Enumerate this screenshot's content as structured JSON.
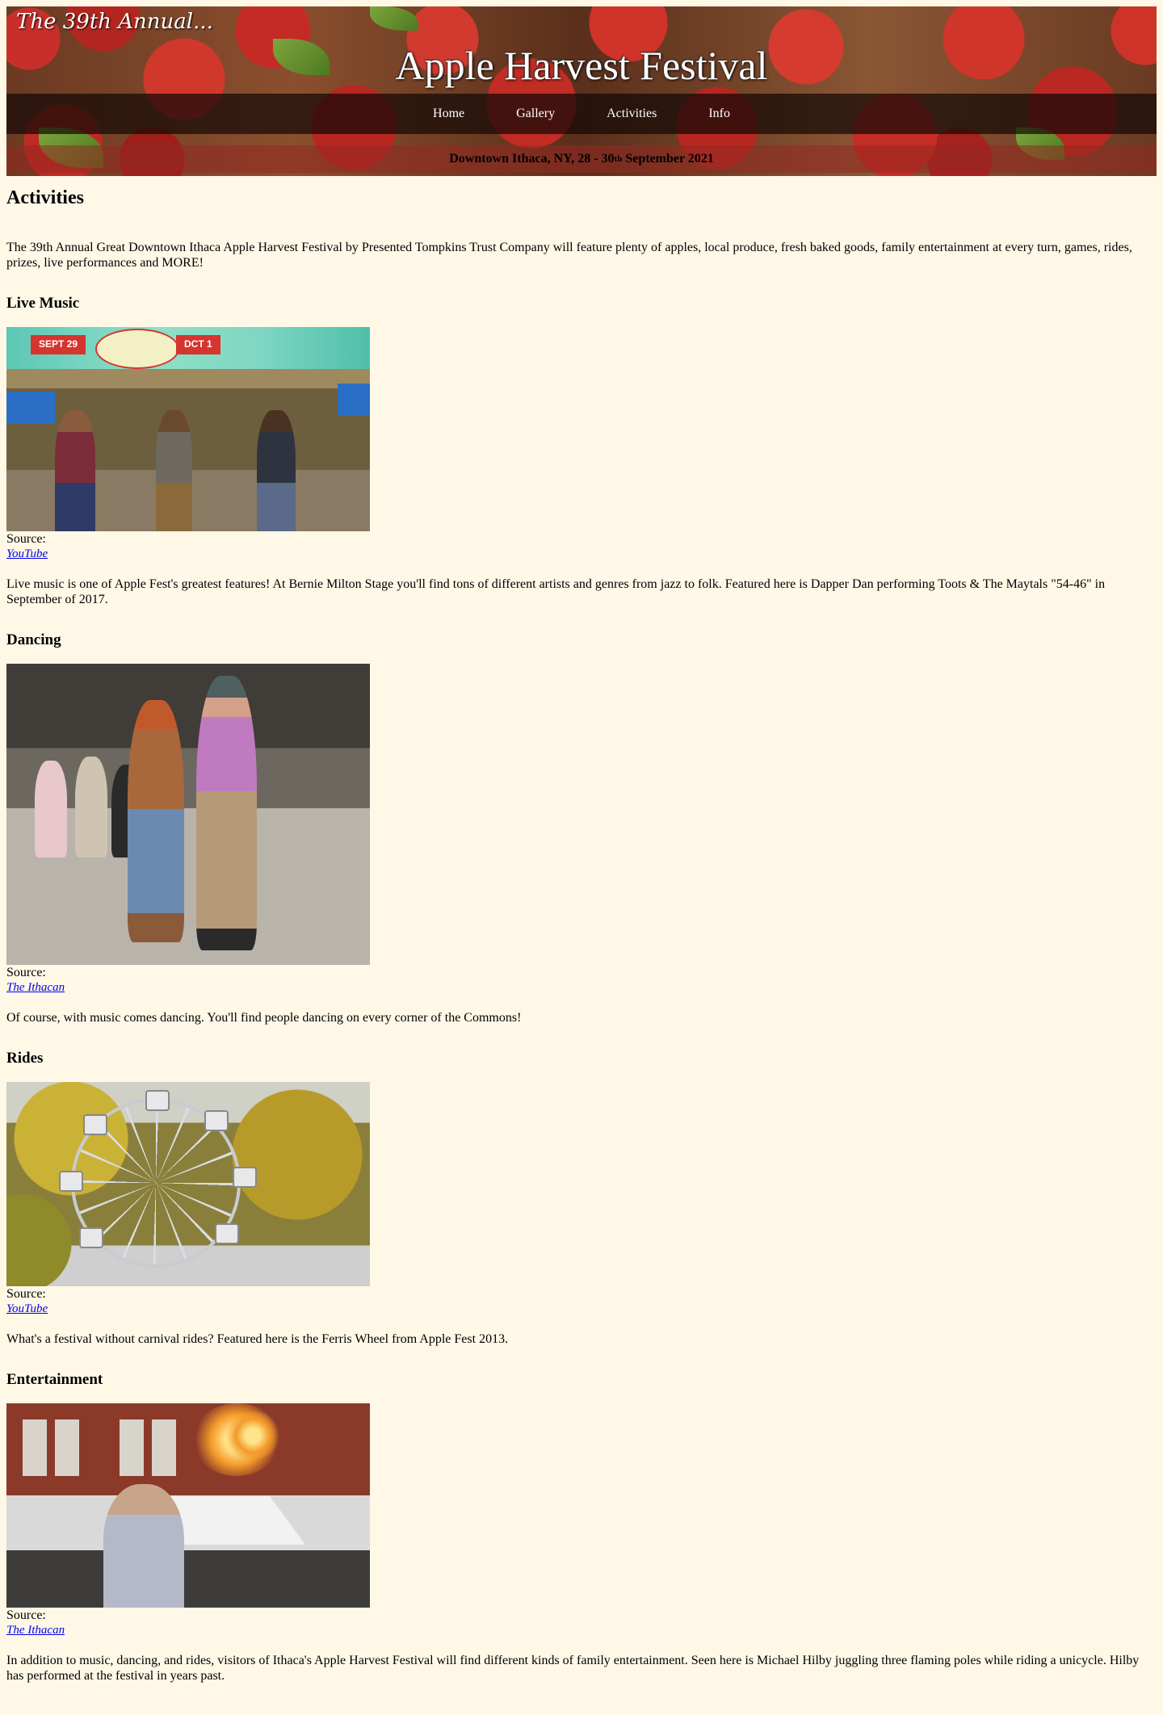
{
  "banner": {
    "kicker": "The 39th Annual...",
    "title": "Apple Harvest Festival",
    "nav": [
      "Home",
      "Gallery",
      "Activities",
      "Info"
    ],
    "date_prefix": "Downtown Ithaca, NY, 28 - 30",
    "date_sup": "th",
    "date_suffix": " September 2021"
  },
  "page": {
    "title": "Activities",
    "intro": "The 39th Annual Great Downtown Ithaca Apple Harvest Festival by Presented Tompkins Trust Company will feature plenty of apples, local produce, fresh baked goods, family entertainment at every turn, games, rides, prizes, live performances and MORE!"
  },
  "sections": [
    {
      "heading": "Live Music",
      "source_label": "Source:",
      "source_link": "YouTube",
      "text": "Live music is one of Apple Fest's greatest features! At Bernie Milton Stage you'll find tons of different artists and genres from jazz to folk. Featured here is Dapper Dan performing Toots & The Maytals \"54-46\" in September of 2017.",
      "photo_banner_left": "SEPT 29",
      "photo_banner_right": "DCT 1"
    },
    {
      "heading": "Dancing",
      "source_label": "Source:",
      "source_link": "The Ithacan",
      "text": "Of course, with music comes dancing. You'll find people dancing on every corner of the Commons!"
    },
    {
      "heading": "Rides",
      "source_label": "Source:",
      "source_link": "YouTube",
      "text": "What's a festival without carnival rides? Featured here is the Ferris Wheel from Apple Fest 2013."
    },
    {
      "heading": "Entertainment",
      "source_label": "Source:",
      "source_link": "The Ithacan",
      "text": "In addition to music, dancing, and rides, visitors of Ithaca's Apple Harvest Festival will find different kinds of family entertainment. Seen here is Michael Hilby juggling three flaming poles while riding a unicycle. Hilby has performed at the festival in years past."
    }
  ],
  "colors": {
    "page_background": "#fff8e7",
    "link": "#0000ee",
    "nav_bar": "#140806"
  }
}
